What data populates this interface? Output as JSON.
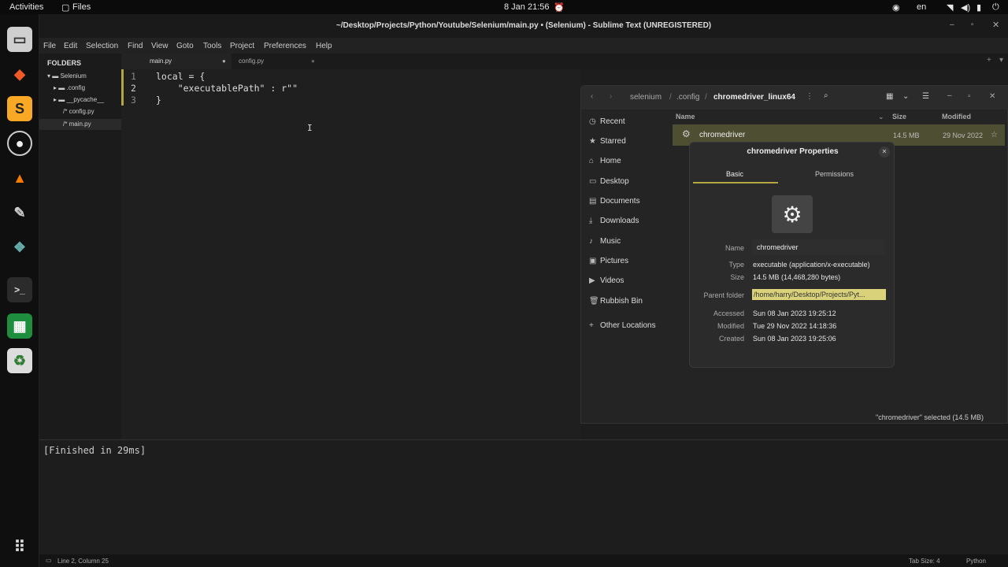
{
  "topbar": {
    "activities": "Activities",
    "app": "Files",
    "datetime": "8 Jan 21:56",
    "lang": "en"
  },
  "window_title": "~/Desktop/Projects/Python/Youtube/Selenium/main.py • (Selenium) - Sublime Text (UNREGISTERED)",
  "menu": [
    "File",
    "Edit",
    "Selection",
    "Find",
    "View",
    "Goto",
    "Tools",
    "Project",
    "Preferences",
    "Help"
  ],
  "sidebar": {
    "header": "FOLDERS",
    "root": "Selenium",
    "items": [
      ".config",
      "__pycache__",
      "config.py",
      "main.py"
    ]
  },
  "tabs": [
    "main.py",
    "config.py"
  ],
  "editor": {
    "lines": [
      {
        "n": "1",
        "text": "local = {"
      },
      {
        "n": "2",
        "text": "    \"executablePath\" : r\"\""
      },
      {
        "n": "3",
        "text": "}"
      }
    ]
  },
  "output": "[Finished in 29ms]",
  "status": {
    "left": "Line 2, Column 25",
    "tab": "Tab Size: 4",
    "syntax": "Python"
  },
  "files": {
    "breadcrumb": [
      "elenium",
      ".config",
      "chromedriver_linux64"
    ],
    "sidebar": [
      {
        "icon": "clock-icon",
        "label": "Recent"
      },
      {
        "icon": "star-icon",
        "label": "Starred"
      },
      {
        "icon": "home-icon",
        "label": "Home"
      },
      {
        "icon": "folder-icon",
        "label": "Desktop"
      },
      {
        "icon": "document-icon",
        "label": "Documents"
      },
      {
        "icon": "download-icon",
        "label": "Downloads"
      },
      {
        "icon": "music-icon",
        "label": "Music"
      },
      {
        "icon": "picture-icon",
        "label": "Pictures"
      },
      {
        "icon": "video-icon",
        "label": "Videos"
      },
      {
        "icon": "trash-icon",
        "label": "Rubbish Bin"
      },
      {
        "icon": "plus-icon",
        "label": "Other Locations"
      }
    ],
    "columns": {
      "name": "Name",
      "size": "Size",
      "modified": "Modified"
    },
    "row": {
      "name": "chromedriver",
      "size": "14.5 MB",
      "modified": "29 Nov 2022"
    },
    "status": "\"chromedriver\" selected (14.5 MB)"
  },
  "props": {
    "title": "chromedriver Properties",
    "tabs": [
      "Basic",
      "Permissions"
    ],
    "name_label": "Name",
    "name_value": "chromedriver",
    "type_label": "Type",
    "type_value": "executable (application/x-executable)",
    "size_label": "Size",
    "size_value": "14.5 MB (14,468,280 bytes)",
    "parent_label": "Parent folder",
    "parent_value": "/home/harry/Desktop/Projects/Pyt...",
    "accessed_label": "Accessed",
    "accessed_value": "Sun 08 Jan 2023 19:25:12",
    "modified_label": "Modified",
    "modified_value": "Tue 29 Nov 2022 14:18:36",
    "created_label": "Created",
    "created_value": "Sun 08 Jan 2023 19:25:06"
  }
}
